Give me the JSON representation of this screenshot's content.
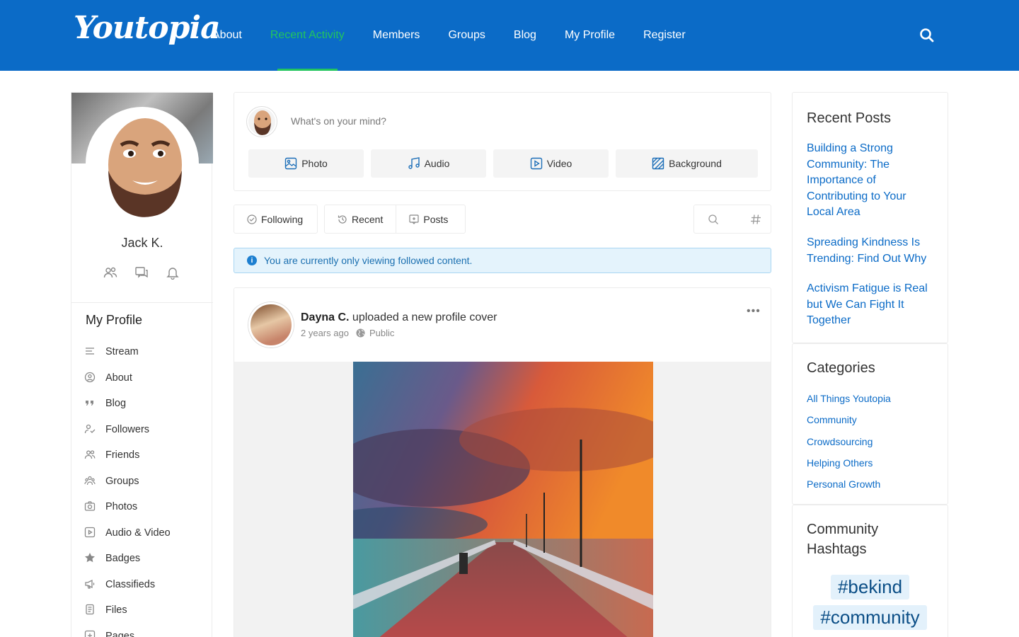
{
  "header": {
    "logo": "Youtopia",
    "nav": [
      "About",
      "Recent Activity",
      "Members",
      "Groups",
      "Blog",
      "My Profile",
      "Register"
    ],
    "active_nav": "Recent Activity",
    "brand_color": "#0b6bc7",
    "active_color": "#22c55e"
  },
  "profile": {
    "name": "Jack K.",
    "section_title": "My Profile",
    "menu": [
      "Stream",
      "About",
      "Blog",
      "Followers",
      "Friends",
      "Groups",
      "Photos",
      "Audio & Video",
      "Badges",
      "Classifieds",
      "Files",
      "Pages"
    ]
  },
  "composer": {
    "placeholder": "What's on your mind?",
    "buttons": [
      "Photo",
      "Audio",
      "Video",
      "Background"
    ]
  },
  "filters": {
    "following": "Following",
    "recent": "Recent",
    "posts": "Posts"
  },
  "notice": "You are currently only viewing followed content.",
  "post": {
    "author": "Dayna C.",
    "action": " uploaded a new profile cover",
    "time": "2 years ago",
    "privacy": "Public"
  },
  "sidebar": {
    "recent_posts_title": "Recent Posts",
    "recent_posts": [
      "Building a Strong Community: The Importance of Contributing to Your Local Area",
      "Spreading Kindness Is Trending: Find Out Why",
      "Activism Fatigue is Real but We Can Fight It Together"
    ],
    "categories_title": "Categories",
    "categories": [
      "All Things Youtopia",
      "Community",
      "Crowdsourcing",
      "Helping Others",
      "Personal Growth"
    ],
    "hashtags_title": "Community Hashtags",
    "hashtags": [
      "#bekind",
      "#community"
    ]
  }
}
